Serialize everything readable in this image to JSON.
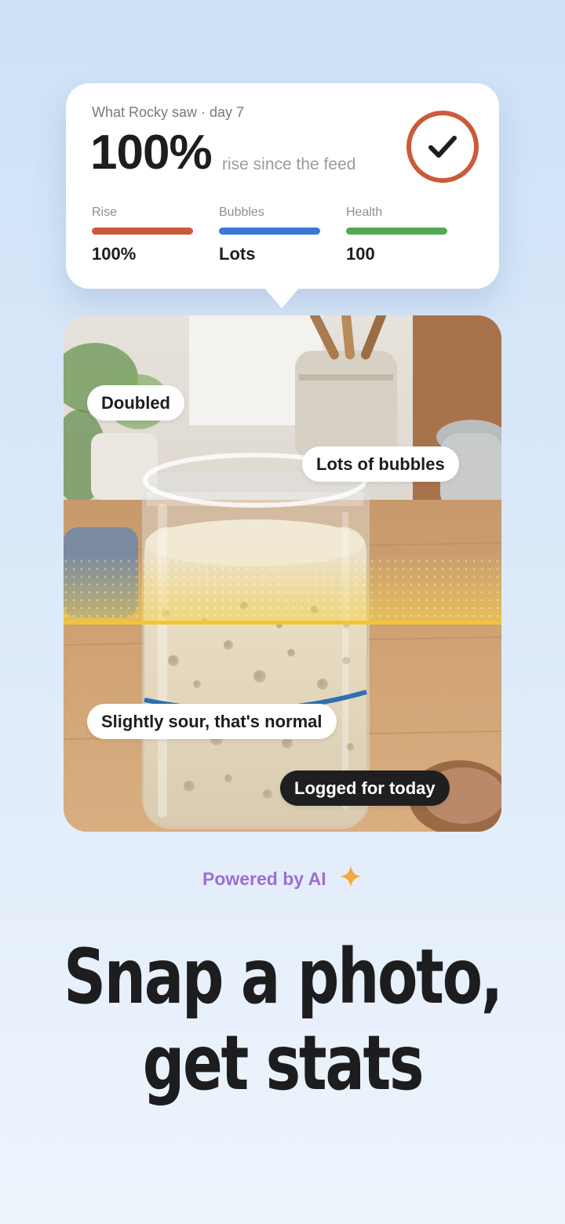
{
  "card": {
    "subtitle": "What Rocky saw · day 7",
    "big_value": "100%",
    "big_caption": "rise since the feed",
    "status_icon": "check-circle-icon",
    "metrics": [
      {
        "label": "Rise",
        "value": "100%",
        "color": "#cc5a3a",
        "fill": 1.0
      },
      {
        "label": "Bubbles",
        "value": "Lots",
        "color": "#3a78d8",
        "fill": 1.0
      },
      {
        "label": "Health",
        "value": "100",
        "color": "#52a855",
        "fill": 1.0
      }
    ]
  },
  "photo": {
    "tags": {
      "doubled": "Doubled",
      "bubbles": "Lots of bubbles",
      "smell": "Slightly sour, that's normal",
      "logged": "Logged for today"
    },
    "rise_line_color": "#f2c43a"
  },
  "footer": {
    "powered": "Powered by AI",
    "powered_icon": "sparkle-icon",
    "headline_line1": "Snap a photo,",
    "headline_line2": "get stats"
  },
  "colors": {
    "accent_purple": "#9a6fd4",
    "sparkle": "#f2a93b",
    "text_dark": "#1d1d1f"
  }
}
